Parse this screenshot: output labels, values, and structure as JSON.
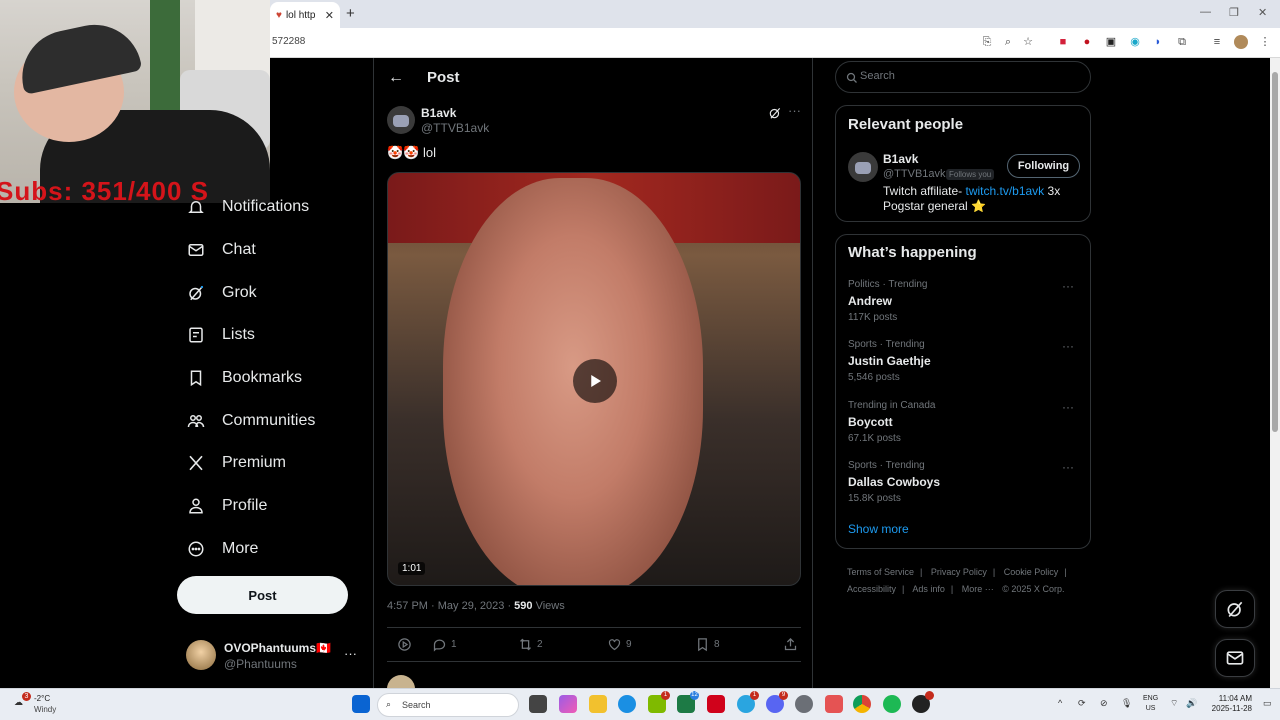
{
  "browser": {
    "tab_title": "lol http",
    "url_fragment": "572288"
  },
  "webcam": {
    "overlay_text": "Subs: 351/400  S"
  },
  "nav": {
    "items": [
      {
        "label": "Notifications",
        "icon": "bell-icon"
      },
      {
        "label": "Chat",
        "icon": "mail-icon"
      },
      {
        "label": "Grok",
        "icon": "grok-icon"
      },
      {
        "label": "Lists",
        "icon": "list-icon"
      },
      {
        "label": "Bookmarks",
        "icon": "bookmark-icon"
      },
      {
        "label": "Communities",
        "icon": "people-icon"
      },
      {
        "label": "Premium",
        "icon": "x-logo-icon"
      },
      {
        "label": "Profile",
        "icon": "person-icon"
      },
      {
        "label": "More",
        "icon": "more-circle-icon"
      }
    ],
    "post_button": "Post",
    "account": {
      "name": "OVOPhantuums🇨🇦",
      "handle": "@Phantuums",
      "more": "···"
    }
  },
  "post": {
    "header_title": "Post",
    "author_name": "B1avk",
    "author_handle": "@TTVB1avk",
    "text": "🤡🤡 lol",
    "video_duration": "1:01",
    "timestamp": "4:57 PM · May 29, 2023 · ",
    "views_count": "590",
    "views_label": " Views",
    "actions": {
      "replies": "1",
      "reposts": "2",
      "likes": "9",
      "bookmarks": "8"
    }
  },
  "search": {
    "placeholder": "Search"
  },
  "relevant_people": {
    "title": "Relevant people",
    "name": "B1avk",
    "handle": "@TTVB1avk",
    "follows_you": "Follows you",
    "following_button": "Following",
    "bio_prefix": "Twitch affiliate- ",
    "bio_link": "twitch.tv/b1avk",
    "bio_suffix": " 3x Pogstar general ⭐"
  },
  "whats_happening": {
    "title": "What’s happening",
    "trends": [
      {
        "category": "Politics · Trending",
        "name": "Andrew",
        "count": "117K posts"
      },
      {
        "category": "Sports · Trending",
        "name": "Justin Gaethje",
        "count": "5,546 posts"
      },
      {
        "category": "Trending in Canada",
        "name": "Boycott",
        "count": "67.1K posts"
      },
      {
        "category": "Sports · Trending",
        "name": "Dallas Cowboys",
        "count": "15.8K posts"
      }
    ],
    "show_more": "Show more"
  },
  "footer": {
    "links": [
      "Terms of Service",
      "|",
      "Privacy Policy",
      "|",
      "Cookie Policy",
      "|",
      "Accessibility",
      "|",
      "Ads info",
      "|",
      "More ···",
      "© 2025 X Corp."
    ]
  },
  "taskbar": {
    "weather_temp": "-2°C",
    "weather_cond": "Windy",
    "weather_badge": "3",
    "search_label": "Search",
    "lang_1": "ENG",
    "lang_2": "US",
    "time": "11:04 AM",
    "date": "2025-11-28"
  },
  "colors": {
    "accent": "#1d9bf0",
    "background": "#000000",
    "border": "#2f3336",
    "muted_text": "#71767b",
    "overlay_red": "#d4141a"
  }
}
